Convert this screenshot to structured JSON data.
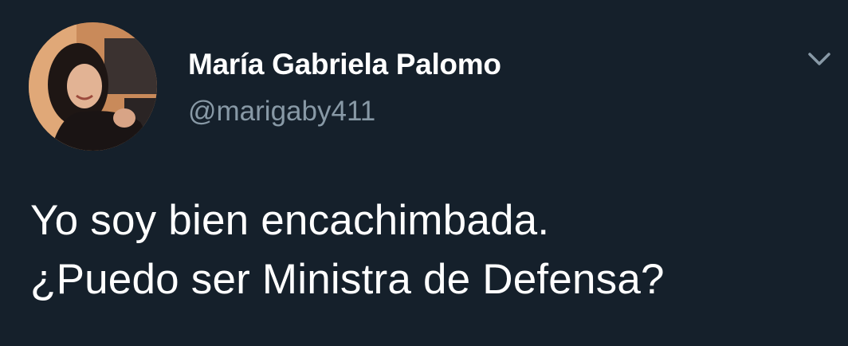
{
  "tweet": {
    "author": {
      "display_name": "María Gabriela Palomo",
      "handle": "@marigaby411",
      "avatar_icon": "profile-photo"
    },
    "text_lines": [
      "Yo soy bien encachimbada.",
      "¿Puedo ser Ministra de Defensa?"
    ],
    "menu_icon": "chevron-down-icon"
  },
  "colors": {
    "background": "#15202b",
    "primary_text": "#ffffff",
    "secondary_text": "#8899a6"
  }
}
